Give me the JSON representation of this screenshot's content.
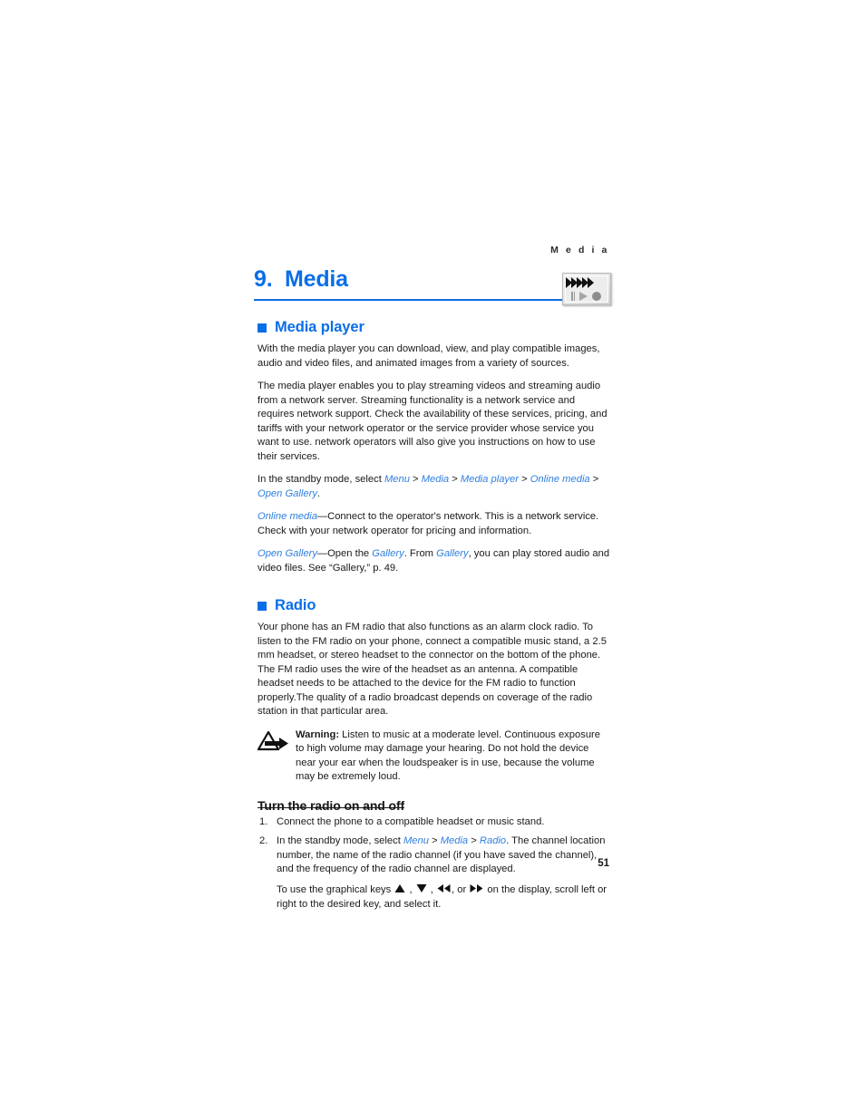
{
  "page": {
    "running_head": "M e d i a",
    "folio": "51",
    "accent_blue": "#0a6ee8",
    "link_blue": "#2f7fe0"
  },
  "chapter": {
    "number": "9.",
    "title": "Media",
    "icon": "media-clapper-icon"
  },
  "sections": [
    {
      "heading": "Media player",
      "bullet": "square-bullet-icon"
    },
    {
      "heading": "Radio",
      "bullet": "square-bullet-icon"
    }
  ],
  "media_player": {
    "para1": "With the media player you can download, view, and play compatible images, audio and video files, and animated images from a variety of sources.",
    "para2": "The media player enables you to play streaming videos and streaming audio from a network server. Streaming functionality is a network service and requires network support. Check the availability of these services, pricing, and tariffs with your network operator or the service provider whose service you want to use. network operators will also give you instructions on how to use their services.",
    "path_intro": "In the standby mode, select ",
    "path_items": [
      "Menu",
      "Media",
      "Media player",
      "Online media",
      "Open Gallery"
    ],
    "path_separator": " > ",
    "path_end": ".",
    "online_media_term": "Online media",
    "online_media_desc": "—Connect to the operator's network. This is a network service. Check with your network operator for pricing and information.",
    "open_gallery_term": "Open Gallery",
    "open_gallery_desc_a": "—Open the ",
    "open_gallery_link1": "Gallery",
    "open_gallery_desc_b": ". From ",
    "open_gallery_link2": "Gallery",
    "open_gallery_desc_c": ", you can play stored audio and video files. See “Gallery,” p. 49."
  },
  "radio": {
    "para1": "Your phone has an FM radio that also functions as an alarm clock radio. To listen to the FM radio on your phone, connect a compatible music stand, a 2.5 mm headset, or stereo headset to the connector on the bottom of the phone. The FM radio uses the wire of the headset as an antenna. A compatible headset needs to be attached to the device for the FM radio to function properly.The quality of a radio broadcast depends on coverage of the radio station in that particular area.",
    "warning": {
      "icon": "warning-triangle-arrow-icon",
      "label": "Warning:",
      "text": " Listen to music at a moderate level. Continuous exposure to high volume may damage your hearing. Do not hold the device near your ear when the loudspeaker is in use, because the volume may be extremely loud."
    },
    "subheading": "Turn the radio on and off",
    "steps": [
      {
        "number": "1.",
        "text": "Connect the phone to a compatible headset or music stand."
      },
      {
        "number": "2.",
        "prefix": "In the standby mode, select ",
        "path_items": [
          "Menu",
          "Media",
          "Radio"
        ],
        "path_separator": " > ",
        "suffix": ". The channel location number, the name of the radio channel (if you have saved the channel), and the frequency of the radio channel are displayed."
      }
    ],
    "substep": {
      "prefix": "To use the graphical keys ",
      "keys": [
        "up-triangle-key",
        "down-triangle-key",
        "rewind-key",
        "fast-forward-key"
      ],
      "key_sep1": " , ",
      "key_sep2": " , ",
      "key_sep3": ", or ",
      "suffix": " on the display, scroll left or right to the desired key, and select it."
    }
  }
}
